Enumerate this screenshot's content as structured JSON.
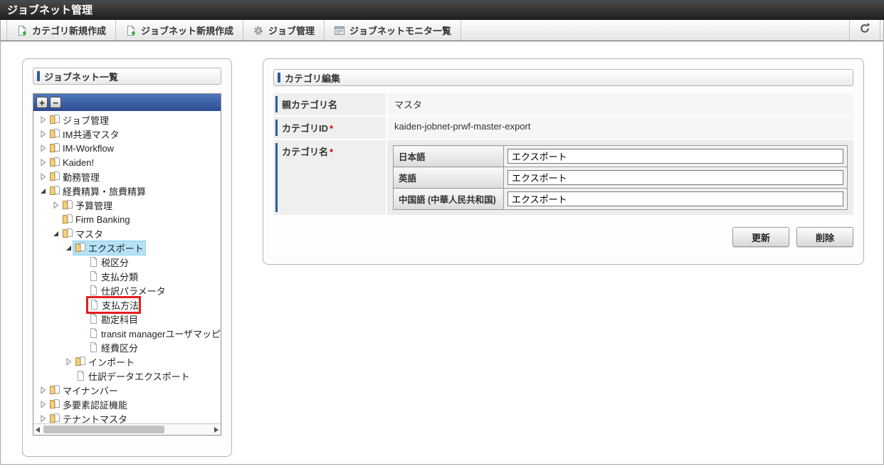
{
  "header": {
    "title": "ジョブネット管理"
  },
  "toolbar": {
    "buttons": [
      {
        "label": "カテゴリ新規作成",
        "icon": "new-document-icon"
      },
      {
        "label": "ジョブネット新規作成",
        "icon": "new-document-icon"
      },
      {
        "label": "ジョブ管理",
        "icon": "gear-icon"
      },
      {
        "label": "ジョブネットモニタ一覧",
        "icon": "list-icon"
      }
    ],
    "refresh_icon": "refresh-icon"
  },
  "tree_panel": {
    "title": "ジョブネット一覧",
    "expand_all_label": "+",
    "collapse_all_label": "−",
    "items": [
      {
        "label": "ジョブ管理",
        "level": 0,
        "expander": "collapsed",
        "icon": "folder",
        "selected": false,
        "annotated": false
      },
      {
        "label": "IM共通マスタ",
        "level": 0,
        "expander": "collapsed",
        "icon": "folder",
        "selected": false,
        "annotated": false
      },
      {
        "label": "IM-Workflow",
        "level": 0,
        "expander": "collapsed",
        "icon": "folder",
        "selected": false,
        "annotated": false
      },
      {
        "label": "Kaiden!",
        "level": 0,
        "expander": "collapsed",
        "icon": "folder",
        "selected": false,
        "annotated": false
      },
      {
        "label": "勤務管理",
        "level": 0,
        "expander": "collapsed",
        "icon": "folder",
        "selected": false,
        "annotated": false
      },
      {
        "label": "経費精算・旅費精算",
        "level": 0,
        "expander": "expanded",
        "icon": "folder",
        "selected": false,
        "annotated": false
      },
      {
        "label": "予算管理",
        "level": 1,
        "expander": "collapsed",
        "icon": "folder",
        "selected": false,
        "annotated": false
      },
      {
        "label": "Firm Banking",
        "level": 1,
        "expander": "none",
        "icon": "folder",
        "selected": false,
        "annotated": false
      },
      {
        "label": "マスタ",
        "level": 1,
        "expander": "expanded",
        "icon": "folder",
        "selected": false,
        "annotated": false
      },
      {
        "label": "エクスポート",
        "level": 2,
        "expander": "expanded",
        "icon": "folder",
        "selected": true,
        "annotated": false
      },
      {
        "label": "税区分",
        "level": 3,
        "expander": "none",
        "icon": "page",
        "selected": false,
        "annotated": false
      },
      {
        "label": "支払分類",
        "level": 3,
        "expander": "none",
        "icon": "page",
        "selected": false,
        "annotated": false
      },
      {
        "label": "仕訳パラメータ",
        "level": 3,
        "expander": "none",
        "icon": "page",
        "selected": false,
        "annotated": false
      },
      {
        "label": "支払方法",
        "level": 3,
        "expander": "none",
        "icon": "page",
        "selected": false,
        "annotated": true
      },
      {
        "label": "勘定科目",
        "level": 3,
        "expander": "none",
        "icon": "page",
        "selected": false,
        "annotated": false
      },
      {
        "label": "transit managerユーザマッピ",
        "level": 3,
        "expander": "none",
        "icon": "page",
        "selected": false,
        "annotated": false
      },
      {
        "label": "経費区分",
        "level": 3,
        "expander": "none",
        "icon": "page",
        "selected": false,
        "annotated": false
      },
      {
        "label": "インポート",
        "level": 2,
        "expander": "collapsed",
        "icon": "folder",
        "selected": false,
        "annotated": false
      },
      {
        "label": "仕訳データエクスポート",
        "level": 2,
        "expander": "none",
        "icon": "page",
        "selected": false,
        "annotated": false
      },
      {
        "label": "マイナンバー",
        "level": 0,
        "expander": "collapsed",
        "icon": "folder",
        "selected": false,
        "annotated": false
      },
      {
        "label": "多要素認証機能",
        "level": 0,
        "expander": "collapsed",
        "icon": "folder",
        "selected": false,
        "annotated": false
      },
      {
        "label": "テナントマスタ",
        "level": 0,
        "expander": "collapsed",
        "icon": "folder",
        "selected": false,
        "annotated": false
      }
    ]
  },
  "editor_panel": {
    "title": "カテゴリ編集",
    "required_marker": "*",
    "rows": [
      {
        "label": "親カテゴリ名",
        "required": false,
        "value": "マスタ"
      },
      {
        "label": "カテゴリID",
        "required": true,
        "value": "kaiden-jobnet-prwf-master-export"
      }
    ],
    "name_row": {
      "label": "カテゴリ名",
      "required": true,
      "languages": [
        {
          "label": "日本語",
          "value": "エクスポート"
        },
        {
          "label": "英語",
          "value": "エクスポート"
        },
        {
          "label": "中国語 (中華人民共和国)",
          "value": "エクスポート"
        }
      ]
    },
    "buttons": {
      "update": "更新",
      "delete": "削除"
    }
  },
  "colors": {
    "accent_blue": "#2e5a9e",
    "tree_header_top": "#5078bd",
    "tree_header_bottom": "#2c4c90",
    "selection": "#b5e2f7",
    "required_red": "#cc0000",
    "annotation_red": "#e41f1f",
    "titlebar_dark": "#1e1e1e"
  }
}
